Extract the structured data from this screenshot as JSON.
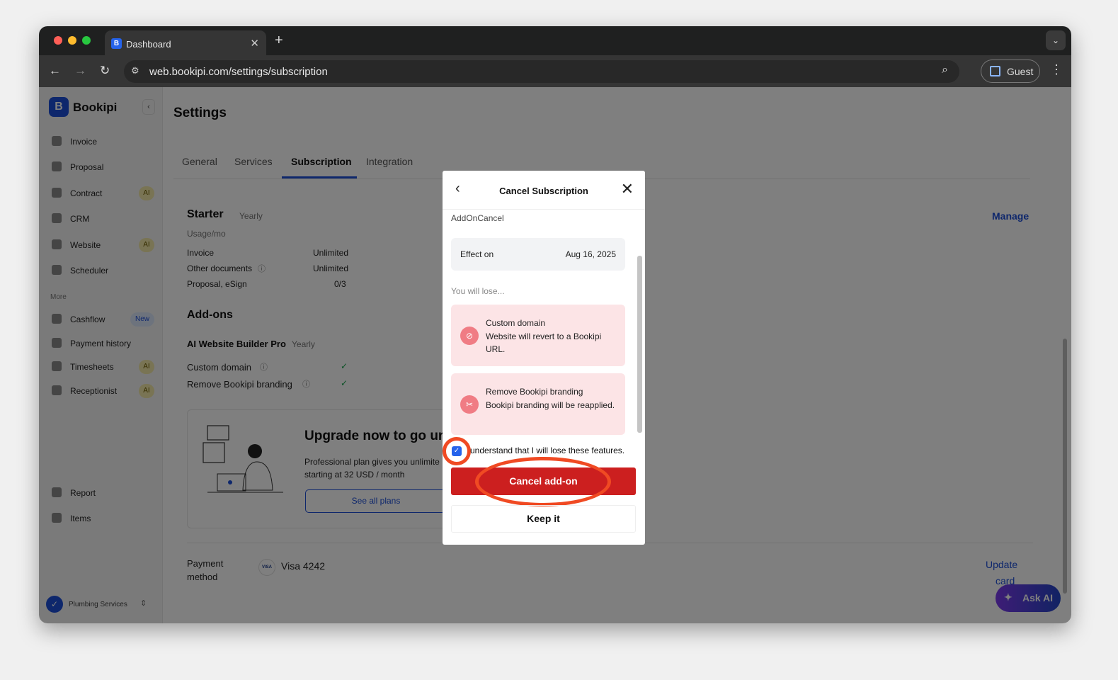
{
  "browser": {
    "tab_title": "Dashboard",
    "url": "web.bookipi.com/settings/subscription",
    "profile": "Guest"
  },
  "sidebar": {
    "brand": "Bookipi",
    "items": [
      {
        "label": "Invoice",
        "icon": "invoice-icon"
      },
      {
        "label": "Proposal",
        "icon": "proposal-icon"
      },
      {
        "label": "Contract",
        "badge": "AI",
        "icon": "contract-icon"
      },
      {
        "label": "CRM",
        "icon": "crm-icon"
      },
      {
        "label": "Website",
        "badge": "AI",
        "icon": "website-icon"
      },
      {
        "label": "Scheduler",
        "icon": "calendar-icon"
      }
    ],
    "more_label": "More",
    "more_items": [
      {
        "label": "Cashflow",
        "badge": "New"
      },
      {
        "label": "Payment history"
      },
      {
        "label": "Timesheets",
        "badge": "AI"
      },
      {
        "label": "Receptionist",
        "badge": "AI"
      }
    ],
    "bottom_items": [
      {
        "label": "Report"
      },
      {
        "label": "Items"
      }
    ],
    "org": "Plumbing Services"
  },
  "main": {
    "title": "Settings",
    "tabs": [
      "General",
      "Services",
      "Subscription",
      "Integration"
    ],
    "active_tab": "Subscription",
    "plan": {
      "name": "Starter",
      "cycle": "Yearly",
      "usage_label": "Usage/mo",
      "manage": "Manage",
      "rows": [
        {
          "label": "Invoice",
          "value": "Unlimited"
        },
        {
          "label": "Other documents",
          "value": "Unlimited"
        },
        {
          "label": "Proposal, eSign",
          "value": "0/3"
        }
      ]
    },
    "addons": {
      "title": "Add-ons",
      "name": "AI Website Builder Pro",
      "cycle": "Yearly",
      "features": [
        "Custom domain",
        "Remove Bookipi branding"
      ]
    },
    "upgrade": {
      "title": "Upgrade now to go ur",
      "text1": "Professional plan gives you unlimite",
      "text2": "starting at 32 USD / month",
      "button": "See all plans"
    },
    "payment": {
      "label1": "Payment",
      "label2": "method",
      "card_brand": "VISA",
      "card": "Visa 4242",
      "update1": "Update",
      "update2": "card"
    },
    "ask_ai": "Ask AI"
  },
  "modal": {
    "title": "Cancel Subscription",
    "subtitle": "AddOnCancel",
    "effect_label": "Effect on",
    "effect_date": "Aug 16, 2025",
    "lose_label": "You will lose...",
    "losses": [
      {
        "title": "Custom domain",
        "desc": "Website will revert to a Bookipi URL."
      },
      {
        "title": "Remove Bookipi branding",
        "desc": "Bookipi branding will be reapplied."
      }
    ],
    "confirm_label": "understand that I will lose these features.",
    "confirm_checked": true,
    "cancel_button": "Cancel add-on",
    "keep_button": "Keep it"
  },
  "colors": {
    "accent": "#1d4ed8",
    "danger": "#cc1f1f",
    "annotation": "#f04a23"
  }
}
